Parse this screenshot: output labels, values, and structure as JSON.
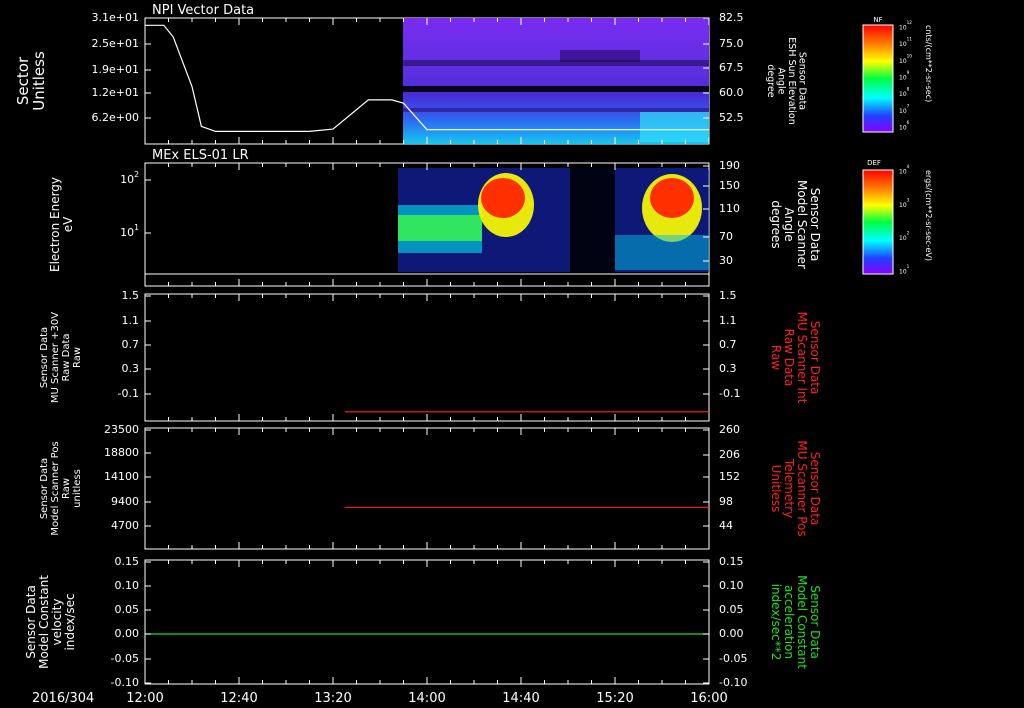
{
  "colors": {
    "background": "#000000",
    "axis": "#ffffff",
    "red": "#ff2020",
    "green": "#20e020",
    "cyan": "#00ffff"
  },
  "time_axis": {
    "date_label": "2016/304",
    "ticks": [
      "12:00",
      "12:40",
      "13:20",
      "14:00",
      "14:40",
      "15:20",
      "16:00"
    ]
  },
  "chart_data": [
    {
      "type": "heatmap",
      "title": "NPI Vector Data",
      "ylabel_left": [
        "Sector",
        "Unitless"
      ],
      "left_ticks": [
        "3.1e+01",
        "2.5e+01",
        "1.9e+01",
        "1.2e+01",
        "6.2e+00"
      ],
      "ylabel_right": [
        "Sensor Data",
        "ESH Sun Elevation",
        "Angle",
        "degree"
      ],
      "right_ticks": [
        "82.5",
        "75.0",
        "67.5",
        "60.0",
        "52.5"
      ],
      "colorbar": {
        "title": "NF",
        "unit": "cnts/(cm**2-sr-sec)",
        "ticks": [
          "10^12",
          "10^11",
          "10^10",
          "10^9",
          "10^8",
          "10^7",
          "10^6"
        ]
      },
      "data_start": "13:37",
      "line": {
        "x": [
          "12:00",
          "12:08",
          "12:12",
          "12:20",
          "12:24",
          "12:30",
          "13:10",
          "13:20",
          "13:35",
          "13:45",
          "13:50",
          "14:00",
          "16:00"
        ],
        "y": [
          82.5,
          82.5,
          79,
          64,
          52,
          50.5,
          50.5,
          51.2,
          60,
          60,
          59,
          51,
          51
        ]
      }
    },
    {
      "type": "heatmap",
      "title": "MEx ELS-01 LR",
      "ylabel_left": [
        "Electron Energy",
        "eV"
      ],
      "left_ticks": [
        "10^2",
        "10^1"
      ],
      "ylabel_right": [
        "Sensor Data",
        "Model Scanner",
        "Angle",
        "degrees"
      ],
      "right_ticks": [
        "190",
        "150",
        "110",
        "70",
        "30"
      ],
      "colorbar": {
        "title": "DEF",
        "unit": "ergs/(cm**2-sr-sec-eV)",
        "ticks": [
          "10^4",
          "10^3",
          "10^2",
          "10^1"
        ]
      },
      "data_start": "13:35"
    },
    {
      "type": "line",
      "ylabel_left": [
        "Sensor Data",
        "MU Scanner +30V",
        "Raw Data",
        "Raw"
      ],
      "left_ticks": [
        "1.5",
        "1.1",
        "0.7",
        "0.3",
        "-0.1"
      ],
      "ylabel_right": [
        "Sensor Data",
        "MU Scanner Int",
        "Raw Data",
        "Raw"
      ],
      "right_ticks": [
        "1.5",
        "1.1",
        "0.7",
        "0.3",
        "-0.1"
      ],
      "ylim": [
        -0.3,
        1.5
      ],
      "series": [
        {
          "x": [
            "13:25",
            "16:00"
          ],
          "y": [
            -0.17,
            -0.17
          ]
        }
      ]
    },
    {
      "type": "line",
      "ylabel_left": [
        "Sensor Data",
        "Model Scanner Pos",
        "Raw",
        "unitless"
      ],
      "left_ticks": [
        "23500",
        "18800",
        "14100",
        "9400",
        "4700"
      ],
      "ylabel_right": [
        "Sensor Data",
        "MU Scanner Pos",
        "Telemetry",
        "Unitless"
      ],
      "right_ticks": [
        "260",
        "206",
        "152",
        "98",
        "44"
      ],
      "ylim": [
        0,
        23500
      ],
      "series": [
        {
          "x": [
            "13:25",
            "16:00"
          ],
          "y": [
            8100,
            8100
          ]
        }
      ]
    },
    {
      "type": "line",
      "ylabel_left": [
        "Sensor Data",
        "Model Constant",
        "velocity",
        "index/sec"
      ],
      "left_ticks": [
        "0.15",
        "0.10",
        "0.05",
        "0.00",
        "-0.05",
        "-0.10"
      ],
      "ylabel_right": [
        "Sensor Data",
        "Model Constant",
        "acceleration",
        "index/sec**2"
      ],
      "right_ticks": [
        "0.15",
        "0.10",
        "0.05",
        "0.00",
        "-0.05",
        "-0.10"
      ],
      "ylim": [
        -0.1,
        0.15
      ],
      "series": [
        {
          "x": [
            "12:00",
            "16:00"
          ],
          "y": [
            0.0,
            0.0
          ]
        }
      ]
    }
  ]
}
